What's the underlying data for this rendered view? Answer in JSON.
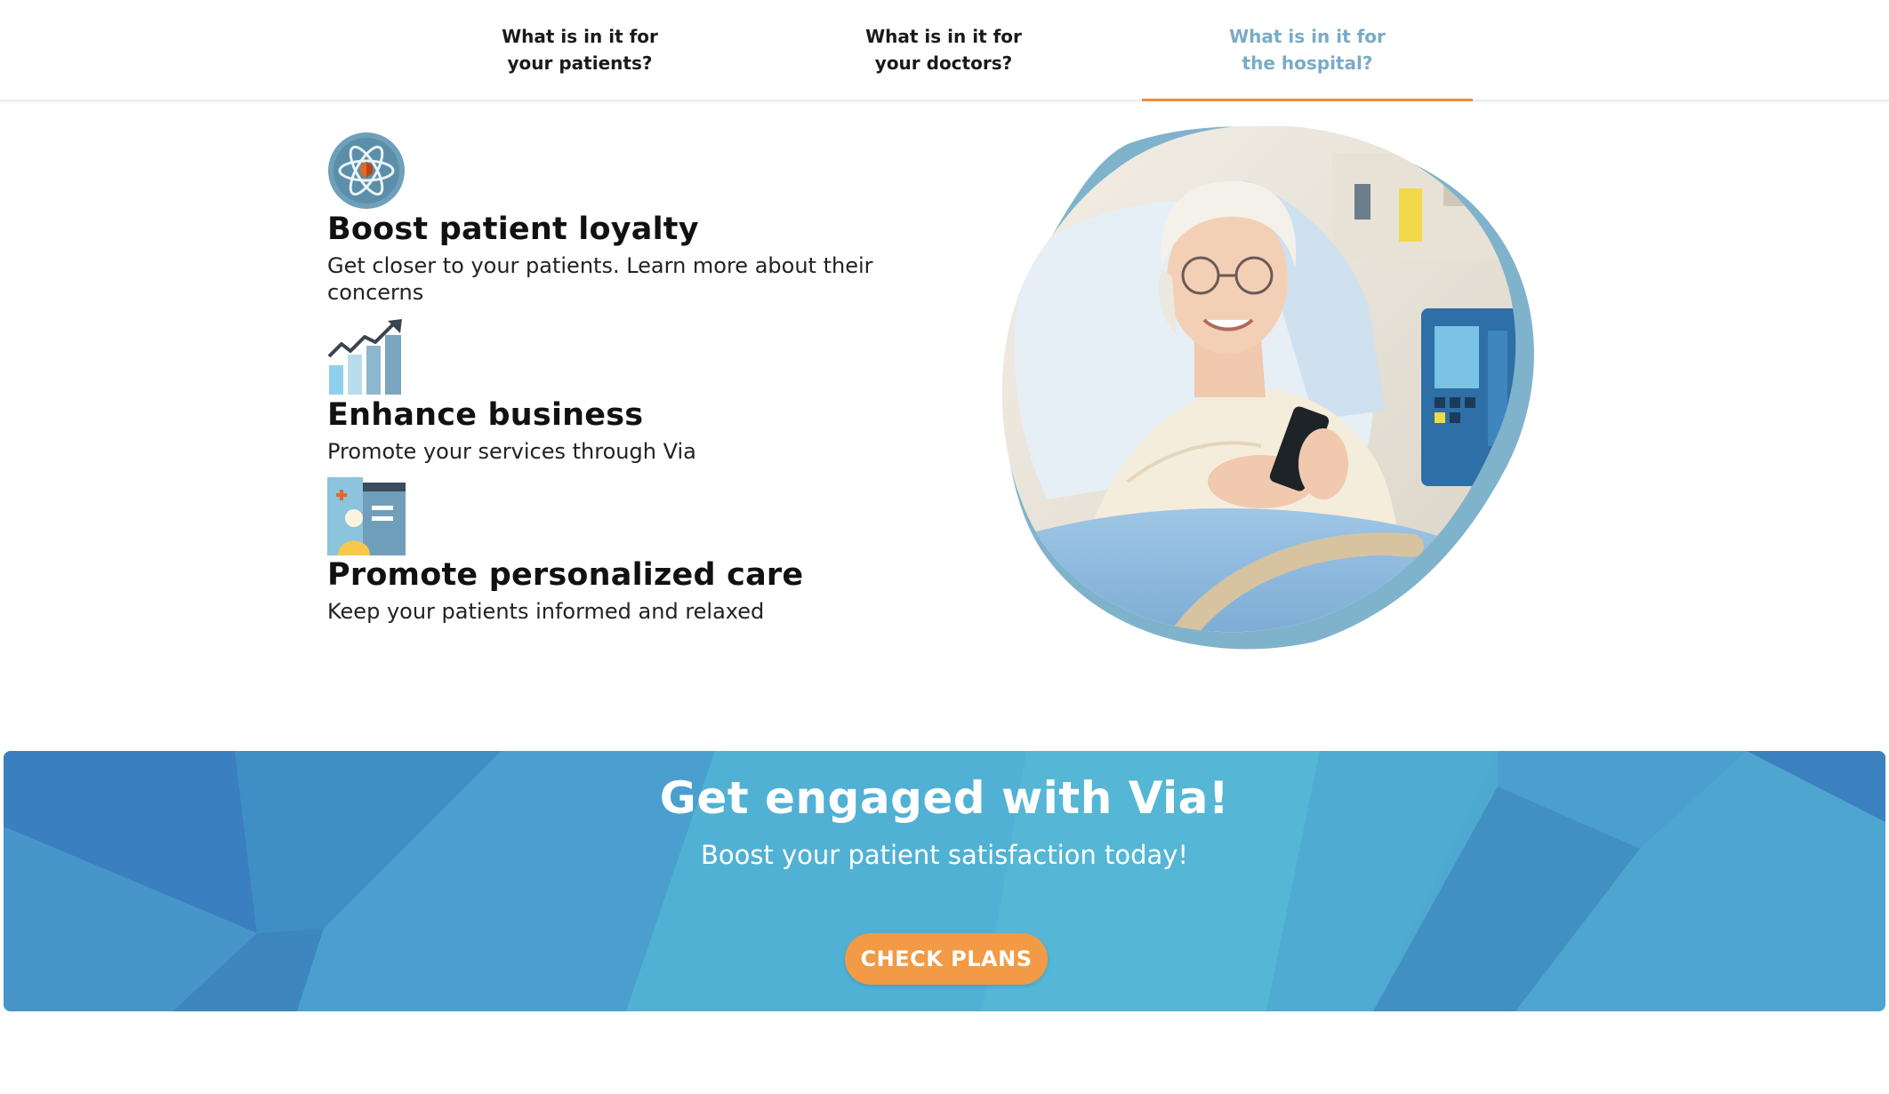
{
  "tabs": [
    {
      "label": "What is in it for\nyour patients?",
      "active": false
    },
    {
      "label": "What is in it for\nyour doctors?",
      "active": false
    },
    {
      "label": "What is in it for\nthe hospital?",
      "active": true
    }
  ],
  "features": [
    {
      "icon": "atom-icon",
      "title": "Boost patient loyalty",
      "text": "Get closer to your patients. Learn more about their concerns"
    },
    {
      "icon": "growth-chart-icon",
      "title": "Enhance business",
      "text": "Promote your services through Via"
    },
    {
      "icon": "patient-card-icon",
      "title": "Promote personalized care",
      "text": "Keep your patients informed and relaxed"
    }
  ],
  "hero": {
    "image": "elderly-patient-with-phone-photo"
  },
  "banner": {
    "title": "Get engaged with Via!",
    "subtitle": "Boost your patient satisfaction today!",
    "cta_label": "CHECK PLANS"
  },
  "colors": {
    "accent_orange": "#ef8a3c",
    "active_tab_text": "#7aabc6",
    "banner_blue": "#4aa6cf",
    "cta_orange": "#f29a45"
  }
}
